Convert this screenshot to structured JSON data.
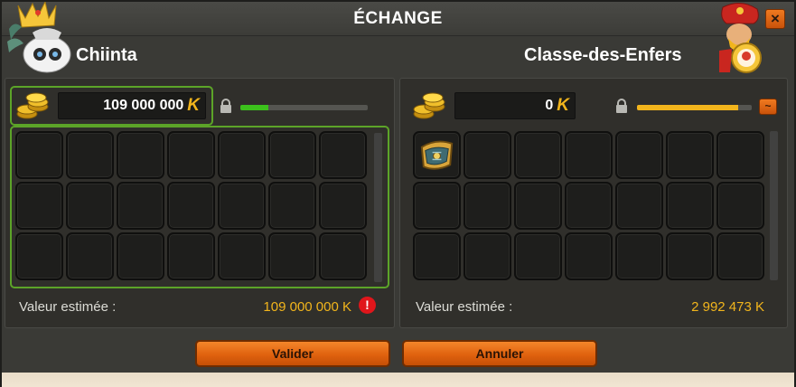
{
  "window": {
    "title": "ÉCHANGE",
    "close_label": "×"
  },
  "left": {
    "player_name": "Chiinta",
    "kamas_value": "109 000 000",
    "kama_symbol": "K",
    "progress": 0.22,
    "progress_color": "#3cc11c",
    "estimate_label": "Valeur estimée :",
    "estimate_value": "109 000 000 K",
    "warning_symbol": "!"
  },
  "right": {
    "player_name": "Classe-des-Enfers",
    "kamas_value": "0",
    "kama_symbol": "K",
    "progress": 0.88,
    "progress_color": "#f2b51c",
    "estimate_label": "Valeur estimée :",
    "estimate_value": "2 992 473 K",
    "items": [
      "item-belt"
    ]
  },
  "buttons": {
    "validate_label": "Valider",
    "cancel_label": "Annuler"
  },
  "colors": {
    "accent": "#e0620f",
    "active_border": "#5ca428",
    "kama_gold": "#f2b51c"
  }
}
